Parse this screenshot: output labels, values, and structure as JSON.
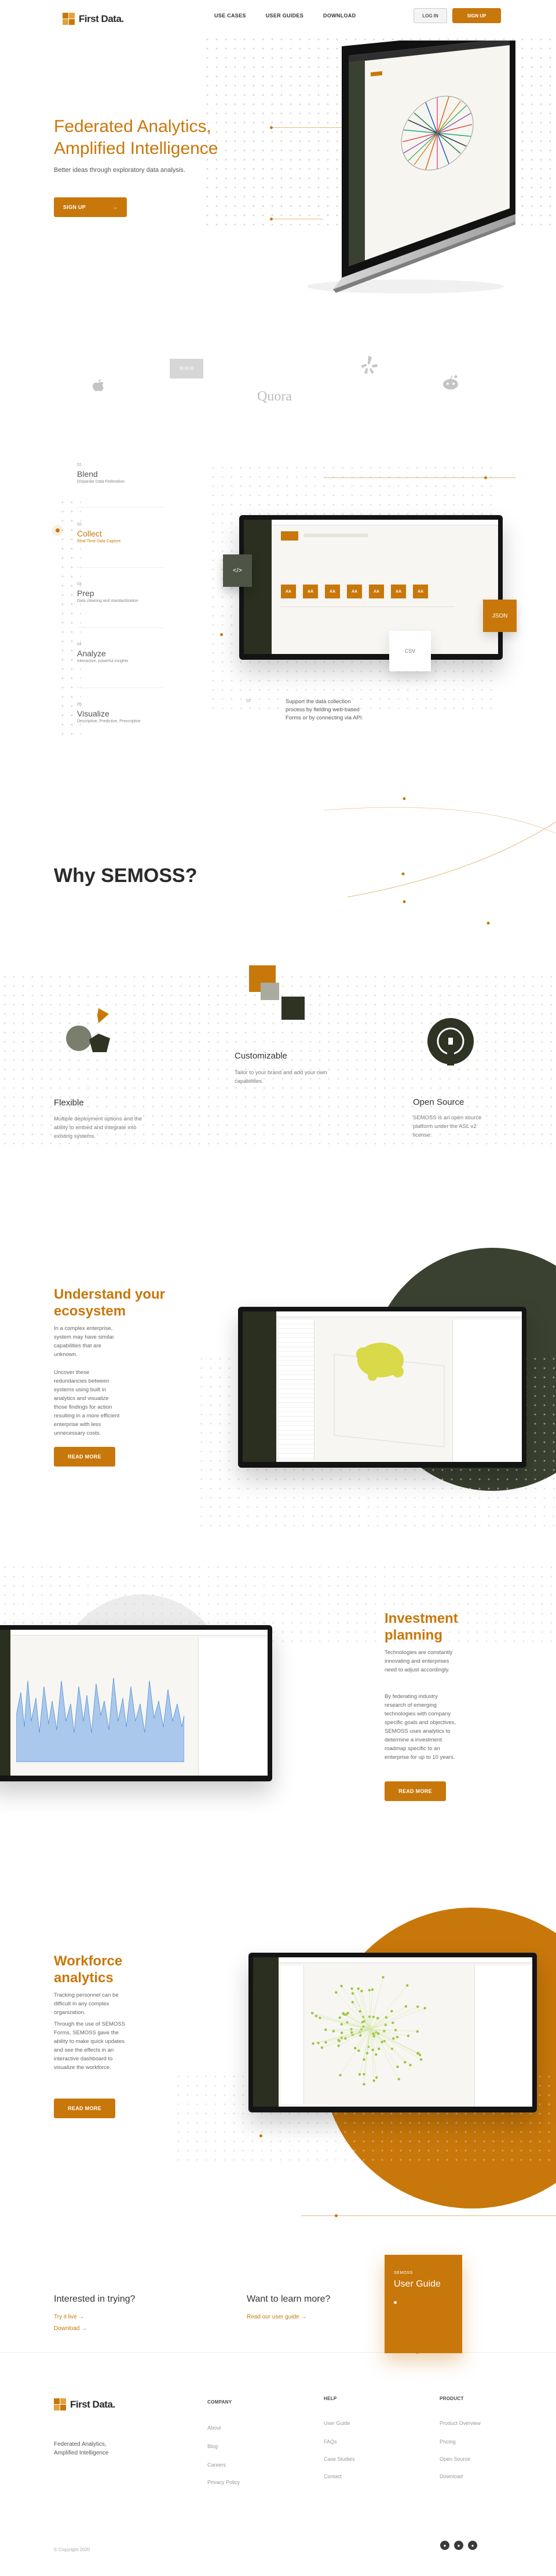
{
  "brand": {
    "name": "First Data."
  },
  "nav": {
    "use_cases": "USE CASES",
    "user_guides": "USER GUIDES",
    "download": "DOWNLOAD"
  },
  "header": {
    "login": "LOG IN",
    "signup": "SIGN UP"
  },
  "hero": {
    "title": "Federated Analytics, Amplified Intelligence",
    "subtitle": "Better ideas through exploratory data analysis.",
    "cta": "SIGN UP"
  },
  "logos": {
    "quora": "Quora"
  },
  "steps": [
    {
      "num": "01",
      "title": "Blend",
      "desc": "Disparate Data Federation"
    },
    {
      "num": "02",
      "title": "Collect",
      "desc": "Real-Time Data Capture"
    },
    {
      "num": "03",
      "title": "Prep",
      "desc": "Data cleaning and standardization"
    },
    {
      "num": "04",
      "title": "Analyze",
      "desc": "Interactive, powerful insights"
    },
    {
      "num": "05",
      "title": "Visualize",
      "desc": "Descriptive, Predictive, Prescriptive"
    }
  ],
  "collect_caption": {
    "num": "02",
    "text": "Support the data collection process by fielding web-based Forms or by connecting via API."
  },
  "collect_demo": {
    "tiles": [
      "AA",
      "AA",
      "AA",
      "AA",
      "AA",
      "AA",
      "AA"
    ],
    "badge_left": "</>",
    "badge_right": "JSON",
    "badge_csv": "CSV"
  },
  "why": {
    "title": "Why SEMOSS?"
  },
  "features": [
    {
      "title": "Flexible",
      "desc": "Multiple deployment options and the ability to embed and integrate into existing systems."
    },
    {
      "title": "Customizable",
      "desc": "Tailor to your brand and add your own capabilities."
    },
    {
      "title": "Open Source",
      "desc": "SEMOSS is an open source platform under the ASL v2 license."
    }
  ],
  "ecosystem": {
    "title": "Understand your ecosystem",
    "p1": "In a complex enterprise, system may have similar capabilities that are unknown.",
    "p2": "Uncover these redundancies between systems using built in analytics and visualize those findings for action resulting in a more efficient enterprise with less unnecessary costs.",
    "cta": "READ MORE"
  },
  "investment": {
    "title": "Investment planning",
    "p1": "Technologies are constantly innovating and enterprises need to adjust accordingly.",
    "p2": "By federating industry research of emerging technologies with company specific goals and objectives, SEMOSS uses analytics to determine a investment roadmap specific to an enterprise for up to 10 years.",
    "cta": "READ MORE"
  },
  "workforce": {
    "title": "Workforce analytics",
    "p1": "Tracking personnel can be difficult in any complex organization.",
    "p2": "Through the use of SEMOSS Forms, SEMOSS gave the ability to make quick updates and see the effects in an interactive dashboard to visualize the workforce.",
    "cta": "READ MORE"
  },
  "try": {
    "title": "Interested in trying?",
    "link1": "Try it live",
    "link2": "Download"
  },
  "learn": {
    "title": "Want to learn more?",
    "link": "Read our user guide"
  },
  "guide_card": {
    "kicker": "SEMOSS",
    "title": "User Guide"
  },
  "footer": {
    "tagline": "Federated Analytics, Amplified Intelligence",
    "company": {
      "title": "COMPANY",
      "links": [
        "About",
        "Blog",
        "Careers",
        "Privacy Policy"
      ]
    },
    "help": {
      "title": "HELP",
      "links": [
        "User Guide",
        "FAQs",
        "Case Studies",
        "Contact"
      ]
    },
    "product": {
      "title": "PRODUCT",
      "links": [
        "Product Overview",
        "Pricing",
        "Open Source",
        "Download"
      ]
    },
    "copyright": "© Copyright 2020"
  },
  "colors": {
    "accent": "#c8770a",
    "dark_green": "#3a4130"
  }
}
